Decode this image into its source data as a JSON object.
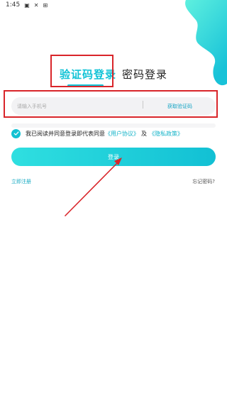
{
  "status_bar": {
    "time": "1:45",
    "icons_left": [
      "image-icon",
      "close-notification-icon",
      "download-icon"
    ],
    "icons_right": [
      "wifi-icon",
      "signal-icon",
      "battery-icon"
    ]
  },
  "tabs": [
    {
      "label": "验证码登录",
      "active": true
    },
    {
      "label": "密码登录",
      "active": false
    }
  ],
  "phone_input": {
    "placeholder": "请输入手机号",
    "value": ""
  },
  "get_code_label": "获取验证码",
  "agreement": {
    "checked": true,
    "text": "我已阅读并同意登录即代表同意",
    "user_agreement": "《用户协议》",
    "joiner": "及",
    "privacy_policy": "《隐私政策》"
  },
  "login_button_label": "登录",
  "register_label": "立即注册",
  "forgot_label": "忘记密码?",
  "colors": {
    "accent": "#12c3d6",
    "link": "#13a9c2",
    "annotation": "#d9252a",
    "field_bg": "#f2f2f4"
  }
}
